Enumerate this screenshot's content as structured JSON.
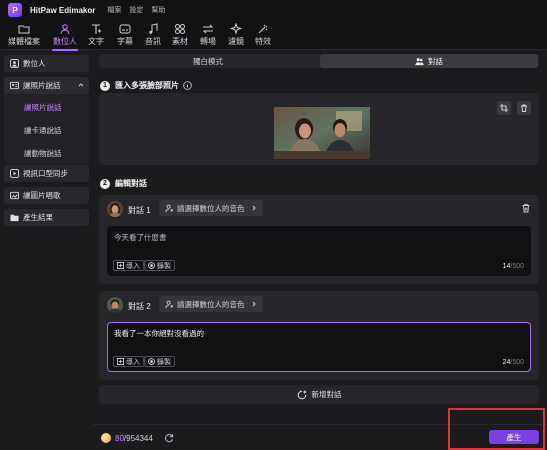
{
  "app": {
    "title": "HitPaw Edimakor",
    "logo_glyph": "P",
    "brand_color": "#b06cff"
  },
  "menu": [
    "檔案",
    "設定",
    "幫助"
  ],
  "toolbar": {
    "items": [
      {
        "label": "媒體檔案",
        "icon": "media-folder-icon"
      },
      {
        "label": "數位人",
        "icon": "digital-human-icon"
      },
      {
        "label": "文字",
        "icon": "text-icon"
      },
      {
        "label": "字幕",
        "icon": "subtitle-icon"
      },
      {
        "label": "音訊",
        "icon": "music-note-icon"
      },
      {
        "label": "素材",
        "icon": "assets-grid-icon"
      },
      {
        "label": "轉場",
        "icon": "transition-arrows-icon"
      },
      {
        "label": "濾鏡",
        "icon": "filter-sparkle-icon"
      },
      {
        "label": "特效",
        "icon": "effects-icon"
      }
    ],
    "active": "數位人"
  },
  "sidebar": {
    "items": [
      {
        "label": "數位人",
        "icon": "person-icon"
      },
      {
        "label": "讓照片說話",
        "icon": "photo-talk-icon",
        "expanded": true
      },
      {
        "label": "視訊口型同步",
        "icon": "video-lipsync-icon"
      },
      {
        "label": "讓圖片唱歌",
        "icon": "image-sing-icon"
      },
      {
        "label": "產生結果",
        "icon": "result-folder-icon"
      }
    ],
    "sub_items": [
      {
        "label": "讓照片說話",
        "active": true
      },
      {
        "label": "讓卡通說話",
        "active": false
      },
      {
        "label": "讓動物說話",
        "active": false
      }
    ]
  },
  "mode_tabs": [
    {
      "label": "獨白模式",
      "active": false
    },
    {
      "label": "對話",
      "icon": "people-icon",
      "active": true
    }
  ],
  "step1": {
    "number": "1",
    "title": "匯入多張臉部照片",
    "info_icon": "info-icon"
  },
  "step2": {
    "number": "2",
    "title": "編輯對話"
  },
  "dialogs": [
    {
      "label": "對話 1",
      "voice_placeholder": "請選擇數位人的音色",
      "text": "今天看了什麽書",
      "import_label": "導入",
      "record_label": "錄製",
      "count": "14",
      "max": "/500",
      "focused": false
    },
    {
      "label": "對話 2",
      "voice_placeholder": "請選擇數位人的音色",
      "text": "我看了一本你絕對沒看過的",
      "import_label": "導入",
      "record_label": "錄製",
      "count": "24",
      "max": "/500",
      "focused": true
    }
  ],
  "add_dialog_label": "新增對話",
  "footer": {
    "credits_used": "80",
    "credits_total": "/954344",
    "generate_label": "產生"
  }
}
